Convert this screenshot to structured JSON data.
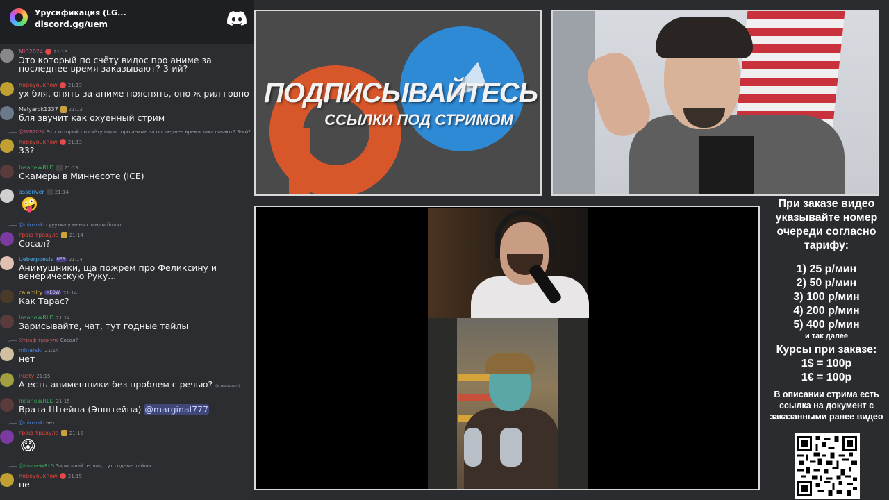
{
  "chat": {
    "server_name": "Урусификация (LG...",
    "server_invite": "discord.gg/uem",
    "messages": [
      {
        "author": "MIB2024",
        "time": "21:13",
        "author_color": "#e05a8a",
        "text": "Это который по счёту видос про аниме за последнее время заказывают? 3-ий?"
      },
      {
        "author": "hopeyouknow",
        "time": "21:13",
        "author_color": "#e0483c",
        "text": "ух бля, опять за аниме пояснять, оно ж рил говно"
      },
      {
        "author": "Malyarok1337",
        "time": "21:13",
        "author_color": "#d8d8d8",
        "text": "бля звучит как охуенный стрим"
      },
      {
        "reply_author": "@MIB2024",
        "reply_text": "Это который по счёту видос про аниме за последнее время заказывают? 3-ий?",
        "author": "hopeyouknow",
        "time": "21:13",
        "author_color": "#e0483c",
        "text": "33?"
      },
      {
        "author": "InsaneWRLD",
        "time": "21:13",
        "author_color": "#3aa85a",
        "text": "Скамеры в Миннесоте (ICE)"
      },
      {
        "author": "assdriver",
        "time": "21:14",
        "author_color": "#4aa8e8",
        "emoji": "🤪"
      },
      {
        "reply_author": "@minarski",
        "reply_text": "сууукка у меня гланды болят",
        "author": "граф трахула",
        "time": "21:14",
        "author_color": "#e0483c",
        "text": "Сосал?"
      },
      {
        "author": "Ueberpoesis",
        "tag": "UEB",
        "time": "21:14",
        "author_color": "#4ab0e8",
        "text": "Анимушники, ща пожрем про Феликсину и венерическую Руку..."
      },
      {
        "author": "calamity",
        "tag": "MEOW",
        "time": "21:14",
        "author_color": "#e8b84a",
        "text": "Как Тарас?"
      },
      {
        "author": "InsaneWRLD",
        "time": "21:14",
        "author_color": "#3aa85a",
        "text": "Зарисывайте, чат, тут годные тайлы"
      },
      {
        "reply_author": "@граф трахула",
        "reply_text": "Сосал?",
        "author": "minarski",
        "time": "21:14",
        "author_color": "#4a88e8",
        "text": "нет"
      },
      {
        "author": "Rusty",
        "time": "21:15",
        "author_color": "#e0483c",
        "text": "А есть анимешники без проблем с речью?",
        "edited": "(изменено)"
      },
      {
        "author": "InsaneWRLD",
        "time": "21:15",
        "author_color": "#3aa85a",
        "text": "Врата Штейна (Эпштейна) ",
        "mention": "@marginal777"
      },
      {
        "reply_author": "@minarski",
        "reply_text": "нет",
        "author": "граф трахула",
        "time": "21:15",
        "author_color": "#e0483c",
        "emoji": "😱"
      },
      {
        "reply_author": "@InsaneWRLD",
        "reply_text": "Зарисывайте, чат, тут годные тайлы",
        "author": "hopeyouknow",
        "time": "21:15",
        "author_color": "#e0483c",
        "text": "не"
      }
    ]
  },
  "promo": {
    "line1": "ПОДПИСЫВАЙТЕСЬ",
    "line2": "ССЫЛКИ ПОД СТРИМОМ"
  },
  "info": {
    "heading": "При заказе видео указывайте номер очереди согласно тарифу:",
    "rates": [
      "1) 25 р/мин",
      "2) 50 р/мин",
      "3) 100 р/мин",
      "4) 200 р/мин",
      "5) 400 р/мин"
    ],
    "etc": "и так далее",
    "courses_title": "Курсы при заказе:",
    "courses": [
      "1$ = 100р",
      "1€ = 100р"
    ],
    "description": "В описании стрима есть ссылка на документ с заказанными ранее видео"
  },
  "colors": {
    "discord_bg": "#2b2d31",
    "header_bg": "#1e1f22",
    "mention_bg": "#3f4678",
    "telegram_blue": "#2f8ad6",
    "boosty_orange": "#d8572a"
  }
}
